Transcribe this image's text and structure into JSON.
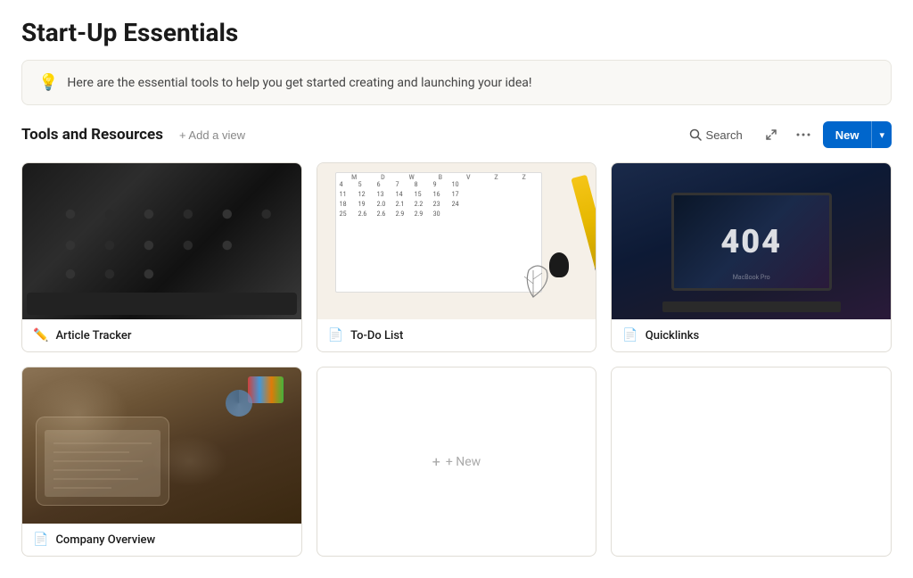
{
  "page": {
    "title": "Start-Up Essentials",
    "banner_icon": "💡",
    "banner_text": "Here are the essential tools to help you get started creating and launching your idea!",
    "section_title": "Tools and Resources",
    "add_view_label": "+ Add a view",
    "search_label": "Search",
    "more_icon": "•••",
    "new_btn_label": "New",
    "new_btn_caret": "▾"
  },
  "cards": [
    {
      "id": "article-tracker",
      "label": "Article Tracker",
      "icon": "✏️",
      "image_type": "typewriter"
    },
    {
      "id": "todo-list",
      "label": "To-Do List",
      "icon": "📄",
      "image_type": "calendar"
    },
    {
      "id": "quicklinks",
      "label": "Quicklinks",
      "icon": "📄",
      "image_type": "laptop"
    },
    {
      "id": "company-overview",
      "label": "Company Overview",
      "icon": "📄",
      "image_type": "desk"
    }
  ],
  "new_card": {
    "label": "+ New"
  }
}
